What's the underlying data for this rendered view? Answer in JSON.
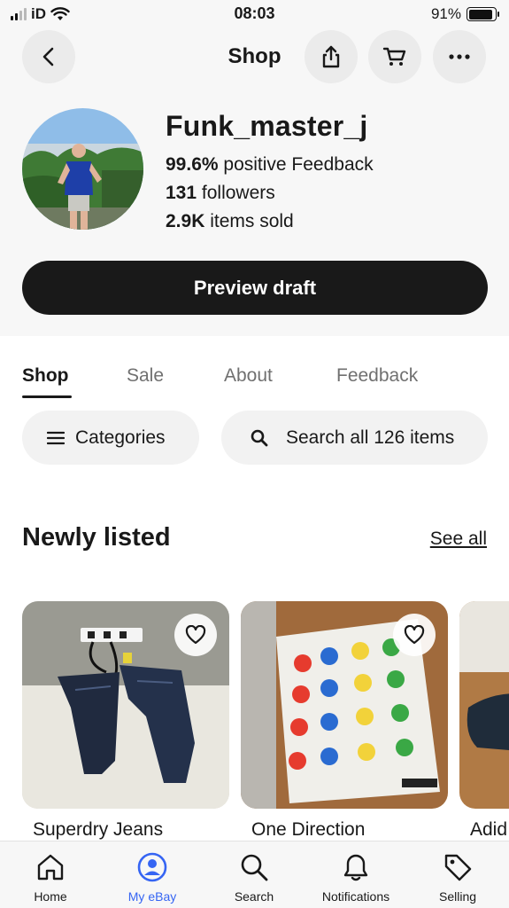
{
  "status_bar": {
    "carrier": "iD",
    "time": "08:03",
    "battery": "91%",
    "battery_level": 0.91
  },
  "header": {
    "title": "Shop",
    "back_icon": "chevron-left-icon",
    "share_icon": "share-icon",
    "cart_icon": "cart-icon",
    "more_icon": "more-horizontal-icon"
  },
  "profile": {
    "name": "Funk_master_j",
    "feedback_value": "99.6%",
    "feedback_label": "positive Feedback",
    "followers_value": "131",
    "followers_label": "followers",
    "sold_value": "2.9K",
    "sold_label": "items sold",
    "preview_button": "Preview draft"
  },
  "tabs": [
    {
      "label": "Shop",
      "active": true
    },
    {
      "label": "Sale",
      "active": false
    },
    {
      "label": "About",
      "active": false
    },
    {
      "label": "Feedback",
      "active": false
    }
  ],
  "filters": {
    "categories_label": "Categories",
    "search_label": "Search all 126 items"
  },
  "newly_listed": {
    "title": "Newly listed",
    "see_all": "See all",
    "items": [
      {
        "title": "Superdry Jeans"
      },
      {
        "title": "One Direction"
      },
      {
        "title": "Adid"
      }
    ]
  },
  "bottom_nav": [
    {
      "label": "Home",
      "icon": "home-icon",
      "active": false
    },
    {
      "label": "My eBay",
      "icon": "user-circle-icon",
      "active": true
    },
    {
      "label": "Search",
      "icon": "search-icon",
      "active": false
    },
    {
      "label": "Notifications",
      "icon": "bell-icon",
      "active": false
    },
    {
      "label": "Selling",
      "icon": "tag-icon",
      "active": false
    }
  ],
  "colors": {
    "accent": "#3665f3",
    "dark": "#191919",
    "surface": "#f7f7f7"
  }
}
